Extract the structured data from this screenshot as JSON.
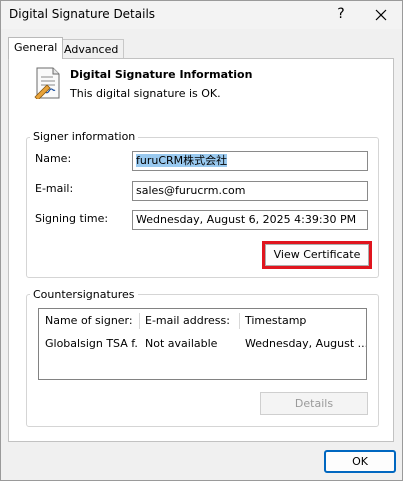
{
  "window": {
    "title": "Digital Signature Details",
    "help_glyph": "?",
    "close_glyph": "✕"
  },
  "tabs": [
    {
      "label": "General",
      "active": true
    },
    {
      "label": "Advanced",
      "active": false
    }
  ],
  "info": {
    "icon": "certificate-document-icon",
    "heading": "Digital Signature Information",
    "status": "This digital signature is OK."
  },
  "signer": {
    "group_label": "Signer information",
    "name_label": "Name:",
    "name_value": "furuCRM株式会社",
    "email_label": "E-mail:",
    "email_value": "sales@furucrm.com",
    "time_label": "Signing time:",
    "time_value": "Wednesday, August 6, 2025 4:39:30 PM",
    "view_certificate_label": "View Certificate"
  },
  "countersignatures": {
    "group_label": "Countersignatures",
    "columns": [
      "Name of signer:",
      "E-mail address:",
      "Timestamp"
    ],
    "rows": [
      [
        "Globalsign TSA f...",
        "Not available",
        "Wednesday, August ..."
      ]
    ],
    "details_label": "Details"
  },
  "footer": {
    "ok_label": "OK"
  },
  "colors": {
    "highlight": "#e0151e",
    "selection": "#99c9ef",
    "ok_border": "#0067c0"
  }
}
